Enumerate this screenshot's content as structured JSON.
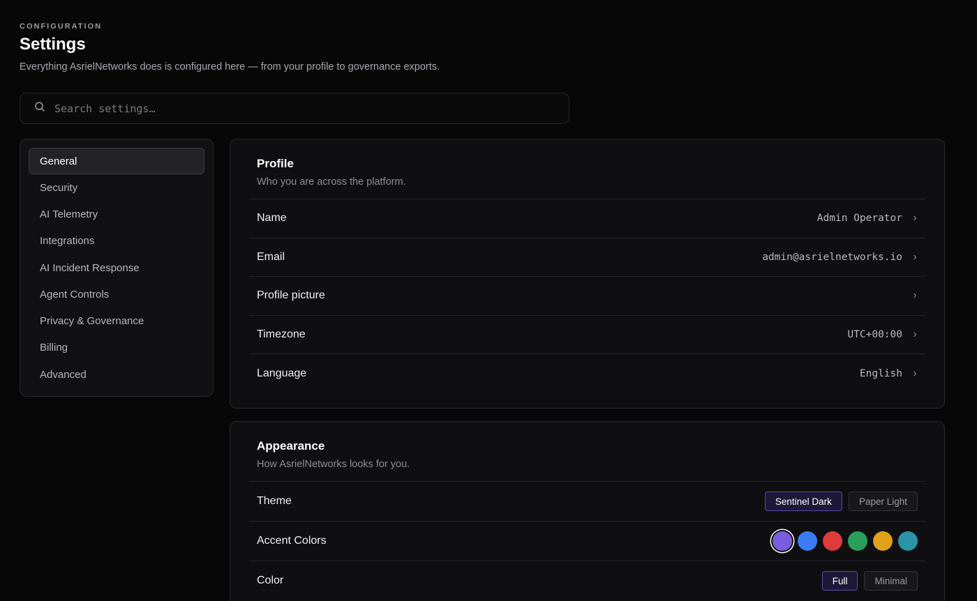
{
  "header": {
    "eyebrow": "CONFIGURATION",
    "title": "Settings",
    "subtitle": "Everything AsrielNetworks does is configured here — from your profile to governance exports."
  },
  "search": {
    "placeholder": "Search settings…",
    "value": ""
  },
  "sidebar": {
    "items": [
      {
        "label": "General",
        "active": true
      },
      {
        "label": "Security"
      },
      {
        "label": "AI Telemetry"
      },
      {
        "label": "Integrations"
      },
      {
        "label": "AI Incident Response"
      },
      {
        "label": "Agent Controls"
      },
      {
        "label": "Privacy & Governance"
      },
      {
        "label": "Billing"
      },
      {
        "label": "Advanced"
      }
    ]
  },
  "profile": {
    "title": "Profile",
    "description": "Who you are across the platform.",
    "rows": [
      {
        "label": "Name",
        "value": "Admin Operator"
      },
      {
        "label": "Email",
        "value": "admin@asrielnetworks.io"
      },
      {
        "label": "Profile picture",
        "value": ""
      },
      {
        "label": "Timezone",
        "value": "UTC+00:00"
      },
      {
        "label": "Language",
        "value": "English"
      }
    ],
    "chevron": "›"
  },
  "appearance": {
    "title": "Appearance",
    "description": "How AsrielNetworks looks for you.",
    "theme": {
      "label": "Theme",
      "options": [
        "Sentinel Dark",
        "Paper Light"
      ],
      "selected": "Sentinel Dark"
    },
    "accent": {
      "label": "Accent Colors",
      "colors": [
        "#7b5cdc",
        "#3b7cf5",
        "#e03b3b",
        "#28a05a",
        "#e0a017",
        "#2a94a8"
      ],
      "selected": "#7b5cdc"
    },
    "color": {
      "label": "Color",
      "options": [
        "Full",
        "Minimal"
      ],
      "selected": "Full"
    }
  },
  "icons": {
    "search": "search-icon",
    "chevron": "chevron-right-icon"
  }
}
